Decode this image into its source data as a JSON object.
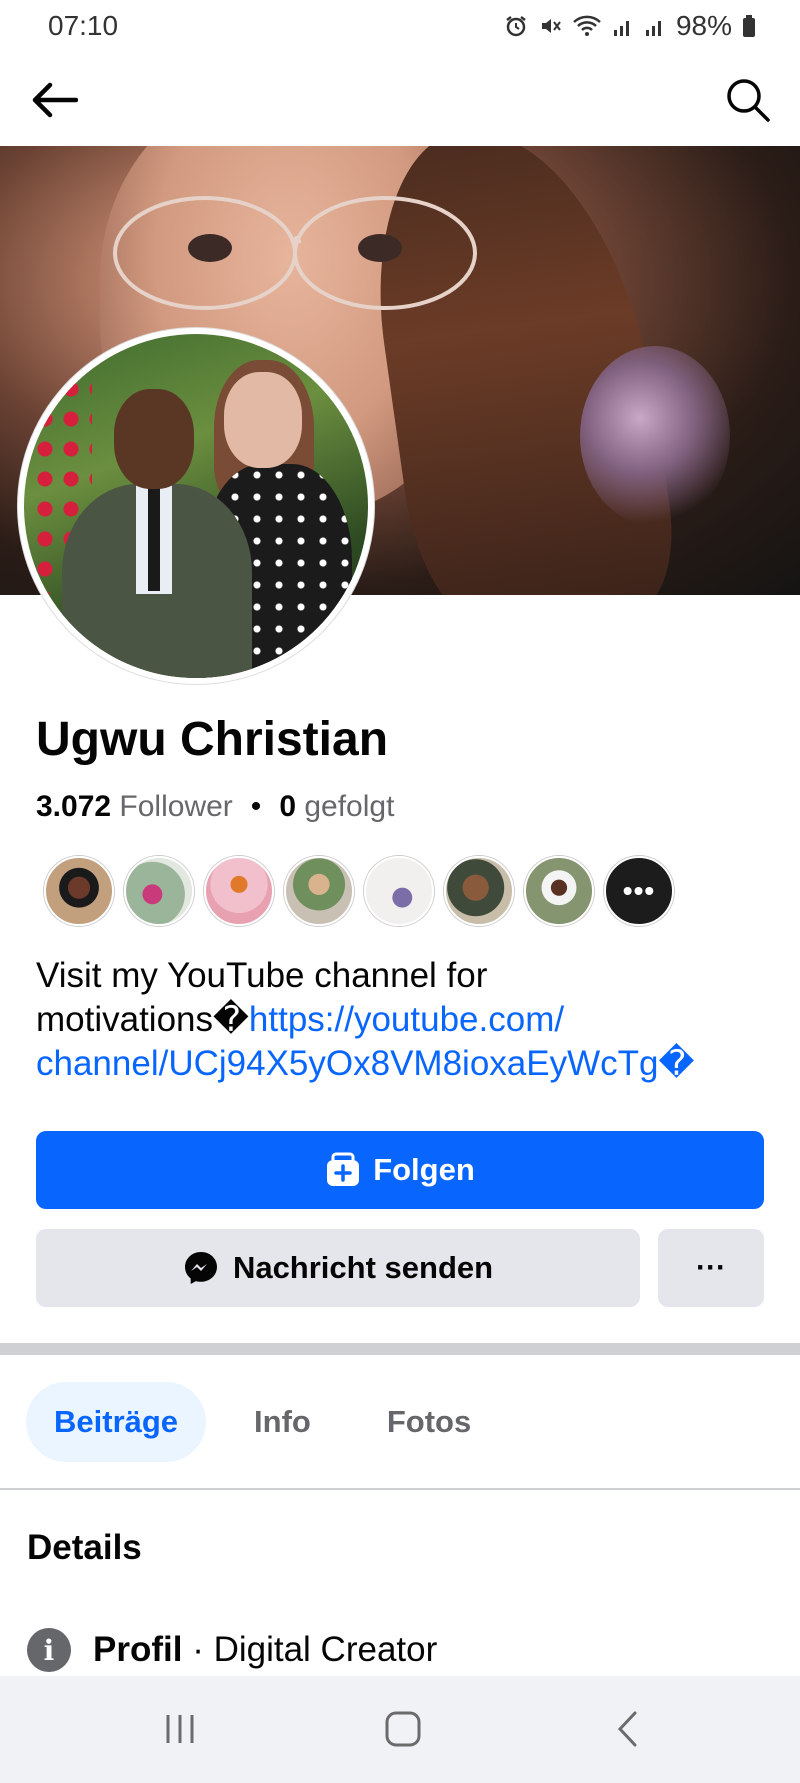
{
  "status_bar": {
    "time": "07:10",
    "battery": "98%",
    "icons": [
      "alarm-icon",
      "mute-icon",
      "wifi-icon",
      "signal-icon",
      "signal-icon",
      "battery-icon"
    ]
  },
  "top_nav": {
    "back_icon": "arrow-left-icon",
    "search_icon": "search-icon"
  },
  "profile": {
    "name": "Ugwu Christian",
    "followers_count": "3.072",
    "followers_label": "Follower",
    "separator": "•",
    "following_count": "0",
    "following_label": "gefolgt",
    "bio_text": "Visit my YouTube channel for motivations�",
    "bio_link": "https://youtube.com/channel/UCj94X5yOx8VM8ioxaEyWcTg",
    "bio_link_line1": "https://youtube.com/",
    "bio_link_line2": "channel/UCj94X5yOx8VM8ioxaEyWcTg",
    "bio_suffix": "�",
    "friend_more": "•••"
  },
  "actions": {
    "follow_label": "Folgen",
    "message_label": "Nachricht senden",
    "more_label": "···"
  },
  "tabs": [
    {
      "label": "Beiträge",
      "active": true
    },
    {
      "label": "Info",
      "active": false
    },
    {
      "label": "Fotos",
      "active": false
    }
  ],
  "details": {
    "title": "Details",
    "rows": [
      {
        "label": "Profil",
        "value": "· Digital Creator"
      }
    ]
  },
  "colors": {
    "accent": "#0866ff",
    "secondary_button": "#e4e6eb",
    "active_tab_bg": "#ebf5ff",
    "muted_text": "#65676b"
  }
}
